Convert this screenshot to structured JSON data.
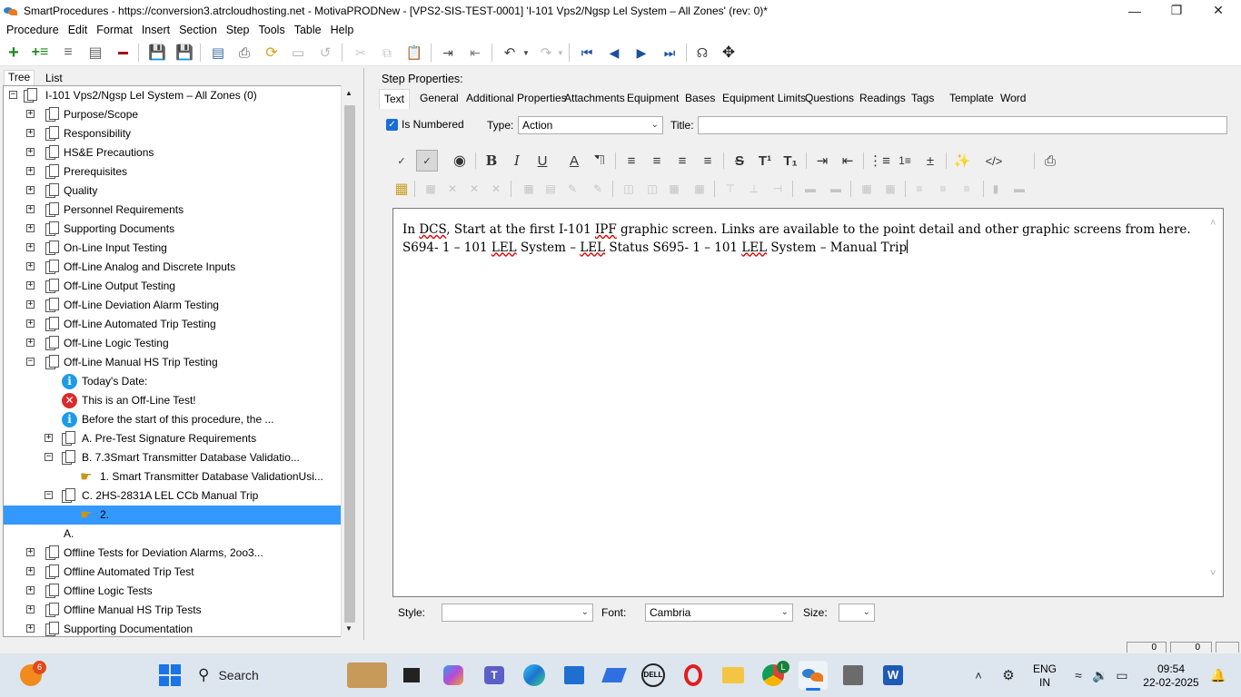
{
  "window": {
    "title": "SmartProcedures - https://conversion3.atrcloudhosting.net - MotivaPRODNew - [VPS2-SIS-TEST-0001] 'I-101 Vps2/Ngsp Lel System – All Zones' (rev: 0)*",
    "controls": [
      "minimize",
      "restore",
      "close"
    ]
  },
  "menu": [
    {
      "label": "Procedure",
      "key": "P"
    },
    {
      "label": "Edit",
      "key": "E"
    },
    {
      "label": "Format",
      "key": "F"
    },
    {
      "label": "Insert",
      "key": "I"
    },
    {
      "label": "Section",
      "key": "S"
    },
    {
      "label": "Step",
      "key": "S"
    },
    {
      "label": "Tools",
      "key": "T"
    },
    {
      "label": "Table",
      "key": "T"
    },
    {
      "label": "Help",
      "key": "H"
    }
  ],
  "left_tabs": {
    "tree": "Tree",
    "list": "List"
  },
  "tree": {
    "root": "I-101 Vps2/Ngsp Lel System – All Zones (0)",
    "items": [
      {
        "label": "Purpose/Scope"
      },
      {
        "label": "Responsibility"
      },
      {
        "label": "HS&E Precautions"
      },
      {
        "label": "Prerequisites"
      },
      {
        "label": "Quality"
      },
      {
        "label": "Personnel Requirements"
      },
      {
        "label": "Supporting Documents"
      },
      {
        "label": "On-Line Input Testing"
      },
      {
        "label": "Off-Line Analog and Discrete Inputs"
      },
      {
        "label": "Off-Line Output Testing"
      },
      {
        "label": "Off-Line Deviation Alarm Testing"
      },
      {
        "label": "Off-Line Automated Trip Testing"
      },
      {
        "label": "Off-Line Logic Testing"
      },
      {
        "label": "Off-Line Manual HS Trip Testing"
      },
      {
        "label": "Today's Date:"
      },
      {
        "label": "This is an Off-Line Test!"
      },
      {
        "label": "Before the start of this procedure, the ..."
      },
      {
        "label": "A. Pre-Test Signature Requirements"
      },
      {
        "label": "B. 7.3Smart Transmitter Database Validatio..."
      },
      {
        "label": "1. Smart Transmitter Database ValidationUsi..."
      },
      {
        "label": "C. 2HS-2831A LEL CCb Manual Trip"
      },
      {
        "label": "2."
      },
      {
        "label": "A."
      },
      {
        "label": "Offline Tests for Deviation Alarms, 2oo3..."
      },
      {
        "label": "Offline Automated Trip Test"
      },
      {
        "label": "Offline Logic Tests"
      },
      {
        "label": "Offline Manual HS Trip Tests"
      },
      {
        "label": "Supporting Documentation"
      }
    ]
  },
  "step_properties": {
    "label": "Step Properties:",
    "tabs": [
      "Text",
      "General",
      "Additional Properties",
      "Attachments",
      "Equipment",
      "Bases",
      "Equipment Limits",
      "Questions",
      "Readings",
      "Tags",
      "Template",
      "Word"
    ],
    "active_tab": "Text",
    "is_numbered_label": "Is Numbered",
    "is_numbered": true,
    "type_label": "Type:",
    "type_value": "Action",
    "title_label": "Title:",
    "title_value": ""
  },
  "editor": {
    "line1_a": "In ",
    "line1_dcs": "DCS",
    "line1_b": ", Start at the first I-101 ",
    "line1_ipf": "IPF",
    "line1_c": " graphic screen. Links are available to the point detail and other graphic screens from here.",
    "line2_a": "S694- 1 – 101 ",
    "line2_lel1": "LEL",
    "line2_b": " System – ",
    "line2_lel2": "LEL",
    "line2_c": " Status S695- 1 – 101 ",
    "line2_lel3": "LEL",
    "line2_d": " System – Manual Trip"
  },
  "format_bar": {
    "style_label": "Style:",
    "style_value": "",
    "font_label": "Font:",
    "font_value": "Cambria",
    "size_label": "Size:",
    "size_value": ""
  },
  "status": {
    "box1": "0",
    "box2": "0"
  },
  "taskbar": {
    "search_label": "Search",
    "notification_count": "6",
    "language": "ENG",
    "region": "IN",
    "time": "09:54",
    "date": "22-02-2025",
    "chrome_badge": "L"
  },
  "colors": {
    "selection": "#3399ff",
    "checkbox": "#1a6fd4",
    "taskbar": "#dde6ef",
    "misspell": "#dd0000"
  }
}
